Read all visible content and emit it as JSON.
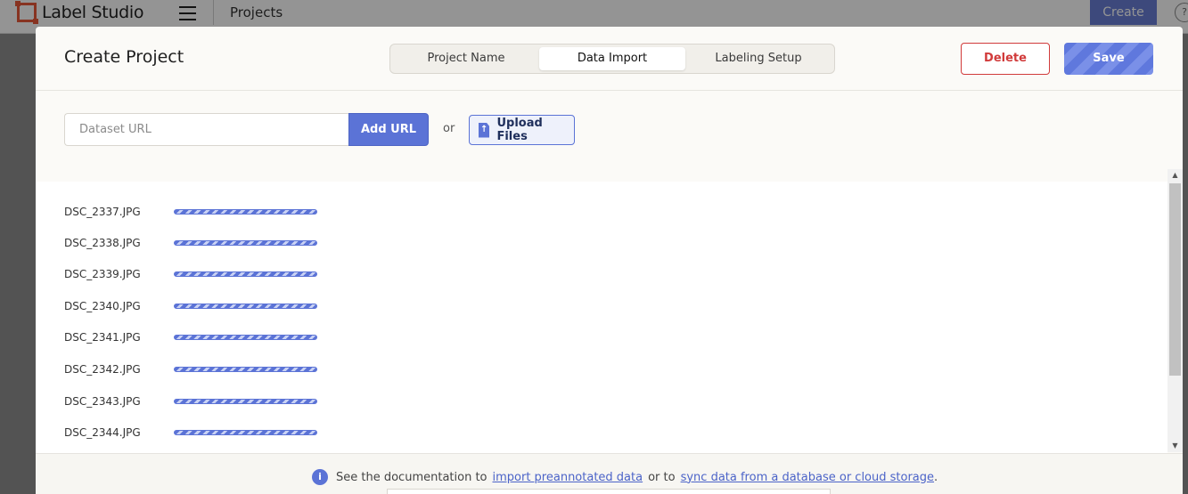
{
  "app": {
    "name": "Label Studio",
    "breadcrumb": "Projects",
    "create_label": "Create",
    "help_glyph": "?"
  },
  "modal": {
    "title": "Create Project",
    "steps": [
      "Project Name",
      "Data Import",
      "Labeling Setup"
    ],
    "active_step": "Data Import",
    "delete_label": "Delete",
    "save_label": "Save"
  },
  "import": {
    "url_placeholder": "Dataset URL",
    "url_value": "",
    "add_url_label": "Add URL",
    "or_text": "or",
    "upload_label": "Upload Files"
  },
  "files": [
    {
      "name": "DSC_2337.JPG",
      "status": "uploading"
    },
    {
      "name": "DSC_2338.JPG",
      "status": "uploading"
    },
    {
      "name": "DSC_2339.JPG",
      "status": "uploading"
    },
    {
      "name": "DSC_2340.JPG",
      "status": "uploading"
    },
    {
      "name": "DSC_2341.JPG",
      "status": "uploading"
    },
    {
      "name": "DSC_2342.JPG",
      "status": "uploading"
    },
    {
      "name": "DSC_2343.JPG",
      "status": "uploading"
    },
    {
      "name": "DSC_2344.JPG",
      "status": "uploading"
    }
  ],
  "footer": {
    "prefix": "See the documentation to",
    "link1": "import preannotated data",
    "middle": "or to",
    "link2": "sync data from a database or cloud storage",
    "suffix": "."
  },
  "icons": {
    "logo": "label-studio-logo-icon",
    "menu": "hamburger-menu-icon",
    "upload": "file-upload-icon",
    "info": "info-icon"
  },
  "colors": {
    "accent": "#5b73d6",
    "danger": "#d13b3b",
    "logo": "#e8593a"
  }
}
